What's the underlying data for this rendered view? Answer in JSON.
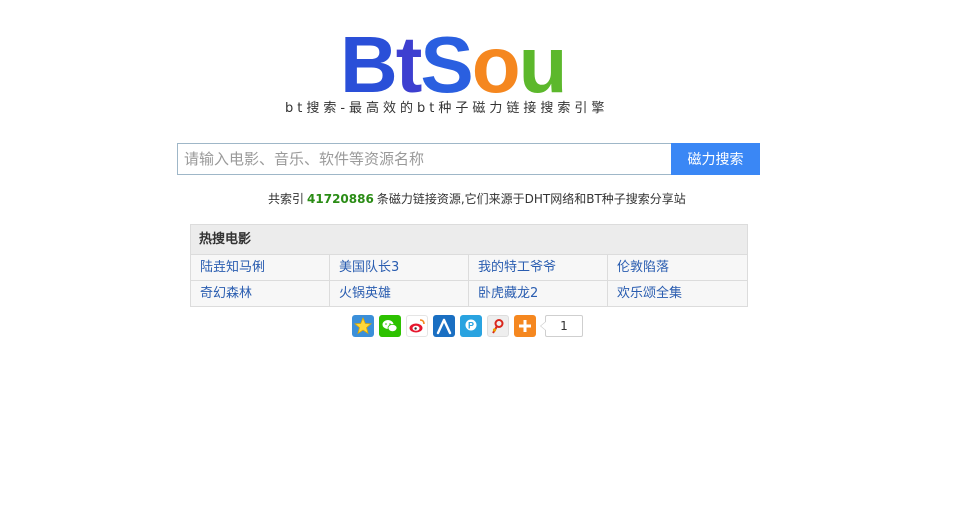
{
  "logo": {
    "letters": [
      {
        "char": "B",
        "color": "#2a4fd8"
      },
      {
        "char": "t",
        "color": "#3d3fd0"
      },
      {
        "char": "S",
        "color": "#2a5fe0"
      },
      {
        "char": "o",
        "color": "#f5871f"
      },
      {
        "char": "u",
        "color": "#5cb82c"
      }
    ]
  },
  "tagline": "bt搜索-最高效的bt种子磁力链接搜索引擎",
  "search": {
    "placeholder": "请输入电影、音乐、软件等资源名称",
    "value": "",
    "button_label": "磁力搜索"
  },
  "stats": {
    "prefix": "共索引",
    "count": "41720886",
    "suffix": "条磁力链接资源,它们来源于DHT网络和BT种子搜索分享站"
  },
  "hot": {
    "title": "热搜电影",
    "rows": [
      [
        "陆垚知马俐",
        "美国队长3",
        "我的特工爷爷",
        "伦敦陷落"
      ],
      [
        "奇幻森林",
        "火锅英雄",
        "卧虎藏龙2",
        "欢乐颂全集"
      ]
    ]
  },
  "share": {
    "icons": [
      {
        "name": "favorite-star-icon",
        "color": "#3b8fd9"
      },
      {
        "name": "wechat-icon",
        "color": "#2dc100"
      },
      {
        "name": "weibo-icon",
        "color": "#e6162d"
      },
      {
        "name": "renren-icon",
        "color": "#1a6fc2"
      },
      {
        "name": "pengyou-icon",
        "color": "#29a3e0"
      },
      {
        "name": "tencent-weibo-icon",
        "color": "#d9d9d9"
      },
      {
        "name": "more-share-icon",
        "color": "#f5871f"
      }
    ],
    "count": "1"
  }
}
